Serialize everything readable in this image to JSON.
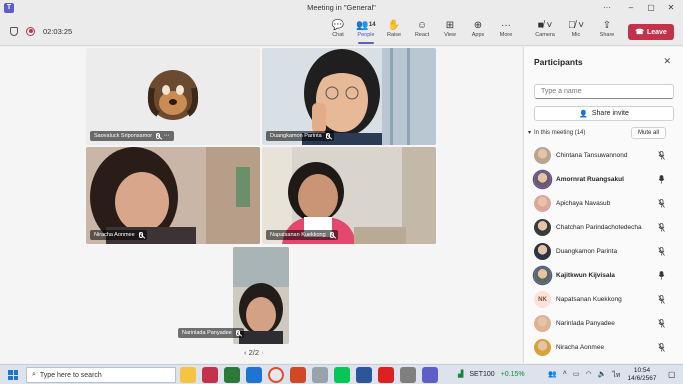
{
  "window": {
    "title": "Meeting in \"General\"",
    "app_icon": "teams-icon"
  },
  "toolbar": {
    "timer": "02:03:25",
    "buttons": [
      {
        "label": "Chat",
        "icon": "chat-icon"
      },
      {
        "label": "People",
        "icon": "people-icon",
        "count": "14"
      },
      {
        "label": "Raise",
        "icon": "raise-hand-icon"
      },
      {
        "label": "React",
        "icon": "react-icon"
      },
      {
        "label": "View",
        "icon": "view-icon"
      },
      {
        "label": "Apps",
        "icon": "apps-icon"
      },
      {
        "label": "More",
        "icon": "more-icon"
      },
      {
        "label": "Camera",
        "icon": "camera-off-icon"
      },
      {
        "label": "Mic",
        "icon": "mic-off-icon"
      },
      {
        "label": "Share",
        "icon": "share-icon"
      }
    ],
    "leave_label": "Leave",
    "accent": "#5b5fc7",
    "leave_color": "#c4314b"
  },
  "stage": {
    "tiles": [
      {
        "name": "Saovaluck Sriponsamor",
        "type": "avatar",
        "has_more": true
      },
      {
        "name": "Duangkamon Parinta",
        "type": "video"
      },
      {
        "name": "Niracha Aonmee",
        "type": "video"
      },
      {
        "name": "Napatsanan Kuekkong",
        "type": "video"
      },
      {
        "name": "Narinlada Panyadee",
        "type": "video"
      }
    ],
    "pager": "2/2"
  },
  "panel": {
    "title": "Participants",
    "search_placeholder": "Type a name",
    "share_invite": "Share invite",
    "in_meeting_label": "In this meeting (14)",
    "mute_all": "Mute all",
    "participants": [
      {
        "name": "Chintana Tansuwannond",
        "mic": "muted",
        "speaking": false,
        "avatar_color": "#b9a48e"
      },
      {
        "name": "Amornrat Ruangsakul",
        "mic": "on",
        "speaking": true,
        "avatar_color": "#6f5a6a"
      },
      {
        "name": "Apichaya Navasub",
        "mic": "muted",
        "speaking": false,
        "avatar_color": "#d9a89b"
      },
      {
        "name": "Chatchan Parindachotedecha",
        "mic": "muted",
        "speaking": false,
        "avatar_color": "#3a3a3a"
      },
      {
        "name": "Duangkamon Parinta",
        "mic": "muted",
        "speaking": false,
        "avatar_color": "#2d3340"
      },
      {
        "name": "Kajitkwun Kijvisala",
        "mic": "on",
        "speaking": true,
        "avatar_color": "#5a6b5c"
      },
      {
        "name": "Napatsanan Kuekkong",
        "mic": "muted",
        "speaking": false,
        "initials": "NK"
      },
      {
        "name": "Narinlada Panyadee",
        "mic": "muted",
        "speaking": false,
        "avatar_color": "#e0b28f"
      },
      {
        "name": "Niracha Aonmee",
        "mic": "muted",
        "speaking": false,
        "avatar_color": "#d7a23a"
      }
    ]
  },
  "taskbar": {
    "search_placeholder": "Type here to search",
    "stock_name": "SET100",
    "stock_change": "+0.15%",
    "time": "10:54",
    "date": "14/6/2567"
  }
}
